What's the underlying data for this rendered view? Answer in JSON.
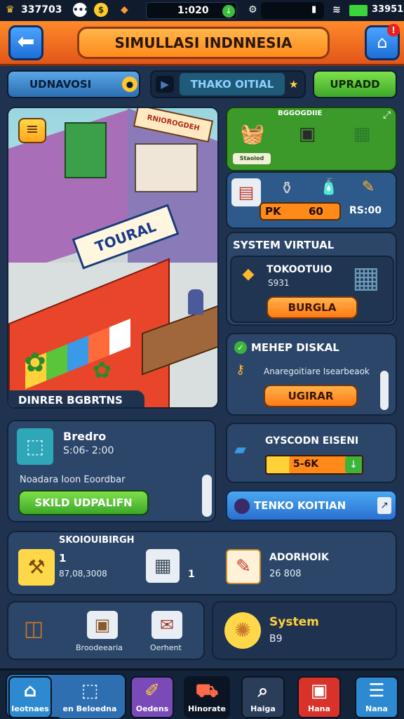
{
  "status_bar": {
    "left_value": "337703",
    "time": "1:020",
    "right_value": "33951"
  },
  "header": {
    "title": "SIMULLASI INDNNESIA",
    "notification_badge": "!"
  },
  "top_tabs": {
    "left": "UDNAVOSI",
    "middle": "THAKO OITIAL",
    "right": "UPRADD"
  },
  "store_scene": {
    "sign": "TOURAL",
    "top_sign": "RNIOROGDEH",
    "caption": "DINRER BGBRTNS"
  },
  "inventory_panel": {
    "title": "BGGOGDIIE",
    "item_label": "Staoiod"
  },
  "price_row": {
    "code": "PK",
    "value": "60",
    "time": "RS:00"
  },
  "system_virtual": {
    "title": "SYSTEM VIRTUAL",
    "item_name": "TOKOOTUIO",
    "item_value": "S931",
    "button": "BURGLA"
  },
  "menu_digital": {
    "title": "MEHEP DISKAL",
    "description": "Anaregoitiare Isearbeaok",
    "button": "UGIRAR"
  },
  "gyscodn": {
    "title": "GYSCODN EISENI",
    "bar_value": "5-6K"
  },
  "tenko": {
    "label": "TENKO KOITIAN"
  },
  "bredro": {
    "title": "Bredro",
    "price": "S:06- 2:00",
    "note": "Noadara Ioon Eoordbar",
    "button": "SKILD UDPALIFN"
  },
  "stats_panel": {
    "title": "SKOIOUIBIRGH",
    "item1_value": "1",
    "item1_sub": "87,08,3008",
    "item2_value": "1",
    "item3_title": "ADORHOIK",
    "item3_sub": "26 808"
  },
  "bottom_left": {
    "item2": "Broodeearia",
    "item3": "Oerhent"
  },
  "system_card": {
    "title": "System",
    "sub": "B9"
  },
  "nav": [
    {
      "label": "Ieotnaes",
      "icon": "home-icon"
    },
    {
      "label": "en Beloedna",
      "icon": "box-icon"
    },
    {
      "label": "Oedens",
      "icon": "paint-icon"
    },
    {
      "label": "Hinorate",
      "icon": "cart-icon"
    },
    {
      "label": "Haiga",
      "icon": "search-icon"
    },
    {
      "label": "Hana",
      "icon": "store-icon"
    },
    {
      "label": "Nana",
      "icon": "menu-icon"
    }
  ],
  "colors": {
    "header_orange": "#ff8a2a",
    "panel_blue": "#2b4668",
    "accent_green": "#3da82a",
    "accent_orange": "#ff7a14"
  }
}
